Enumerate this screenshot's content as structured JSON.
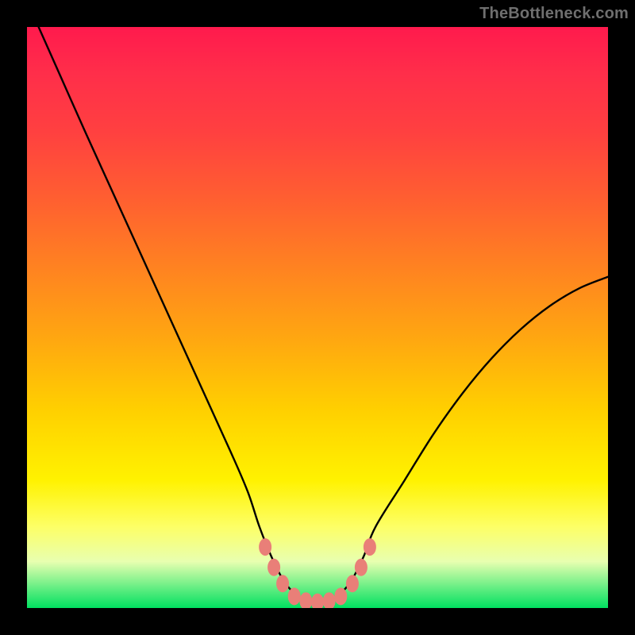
{
  "watermark": {
    "text": "TheBottleneck.com"
  },
  "colors": {
    "background": "#000000",
    "curve_stroke": "#000000",
    "marker_fill": "#e97f78",
    "marker_stroke": "#e97f78",
    "gradient_stops": [
      "#ff1a4d",
      "#ff2e4a",
      "#ff4040",
      "#ff6030",
      "#ff8420",
      "#ffa810",
      "#ffd000",
      "#fff200",
      "#fdff66",
      "#e8ffb0",
      "#00e060"
    ]
  },
  "chart_data": {
    "type": "line",
    "title": "",
    "xlabel": "",
    "ylabel": "",
    "xlim": [
      0,
      100
    ],
    "ylim": [
      0,
      100
    ],
    "grid": false,
    "legend": false,
    "series": [
      {
        "name": "bottleneck-curve",
        "x": [
          2,
          6,
          10,
          15,
          20,
          25,
          30,
          35,
          38,
          40,
          42,
          44,
          46,
          48,
          50,
          52,
          54,
          56,
          58,
          60,
          65,
          70,
          75,
          80,
          85,
          90,
          95,
          100
        ],
        "values": [
          100,
          91,
          82,
          71,
          60,
          49,
          38,
          27,
          20,
          14,
          9,
          5,
          2.5,
          1.3,
          1.0,
          1.3,
          2.5,
          5,
          9,
          14,
          22,
          30,
          37,
          43,
          48,
          52,
          55,
          57
        ]
      }
    ],
    "markers": [
      {
        "x": 41,
        "y": 10.5
      },
      {
        "x": 42.5,
        "y": 7.0
      },
      {
        "x": 44,
        "y": 4.2
      },
      {
        "x": 46,
        "y": 2.0
      },
      {
        "x": 48,
        "y": 1.2
      },
      {
        "x": 50,
        "y": 1.0
      },
      {
        "x": 52,
        "y": 1.2
      },
      {
        "x": 54,
        "y": 2.0
      },
      {
        "x": 56,
        "y": 4.2
      },
      {
        "x": 57.5,
        "y": 7.0
      },
      {
        "x": 59,
        "y": 10.5
      }
    ]
  }
}
